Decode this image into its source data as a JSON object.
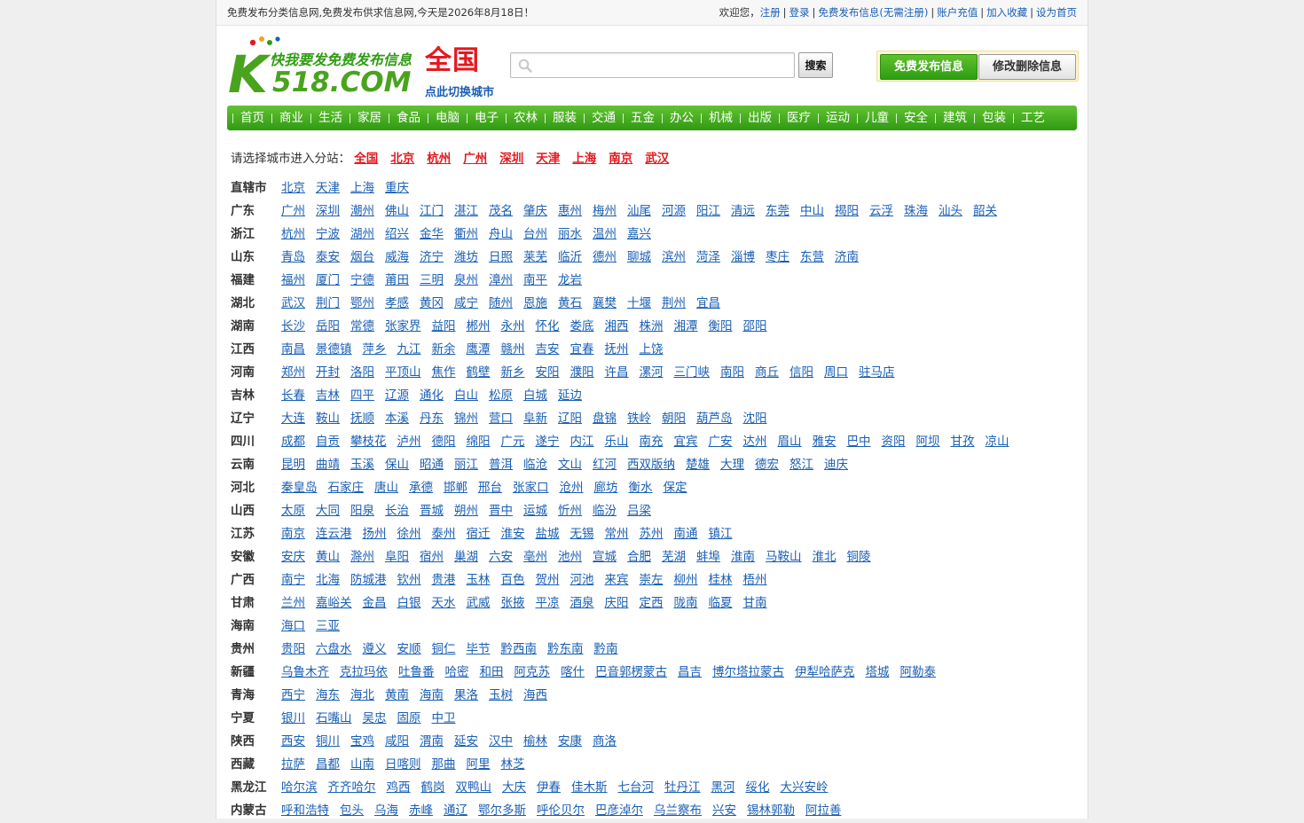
{
  "topbar": {
    "notice": "免费发布分类信息网,免费发布供求信息网,今天是2026年8月18日！",
    "welcome": "欢迎您，",
    "links": [
      "注册",
      "登录",
      "免费发布信息(无需注册)",
      "账户充值",
      "加入收藏",
      "设为首页"
    ]
  },
  "header": {
    "logo_text_top": "快我要发免费发布信息",
    "logo_text_bottom": "518.COM",
    "logo_letter": "K",
    "city": "全国",
    "switch_city": "点此切换城市",
    "search_button": "搜索",
    "search_value": "",
    "post_button": "免费发布信息",
    "edit_button": "修改删除信息"
  },
  "nav": [
    "首页",
    "商业",
    "生活",
    "家居",
    "食品",
    "电脑",
    "电子",
    "农林",
    "服装",
    "交通",
    "五金",
    "办公",
    "机械",
    "出版",
    "医疗",
    "运动",
    "儿童",
    "安全",
    "建筑",
    "包装",
    "工艺"
  ],
  "choose": {
    "label": "请选择城市进入分站：",
    "sites": [
      "全国",
      "北京",
      "杭州",
      "广州",
      "深圳",
      "天津",
      "上海",
      "南京",
      "武汉"
    ]
  },
  "regions": [
    {
      "name": "直辖市",
      "cities": [
        "北京",
        "天津",
        "上海",
        "重庆"
      ]
    },
    {
      "name": "广东",
      "cities": [
        "广州",
        "深圳",
        "潮州",
        "佛山",
        "江门",
        "湛江",
        "茂名",
        "肇庆",
        "惠州",
        "梅州",
        "汕尾",
        "河源",
        "阳江",
        "清远",
        "东莞",
        "中山",
        "揭阳",
        "云浮",
        "珠海",
        "汕头",
        "韶关"
      ]
    },
    {
      "name": "浙江",
      "cities": [
        "杭州",
        "宁波",
        "湖州",
        "绍兴",
        "金华",
        "衢州",
        "舟山",
        "台州",
        "丽水",
        "温州",
        "嘉兴"
      ]
    },
    {
      "name": "山东",
      "cities": [
        "青岛",
        "泰安",
        "烟台",
        "威海",
        "济宁",
        "潍坊",
        "日照",
        "莱芜",
        "临沂",
        "德州",
        "聊城",
        "滨州",
        "菏泽",
        "淄博",
        "枣庄",
        "东营",
        "济南"
      ]
    },
    {
      "name": "福建",
      "cities": [
        "福州",
        "厦门",
        "宁德",
        "莆田",
        "三明",
        "泉州",
        "漳州",
        "南平",
        "龙岩"
      ]
    },
    {
      "name": "湖北",
      "cities": [
        "武汉",
        "荆门",
        "鄂州",
        "孝感",
        "黄冈",
        "咸宁",
        "随州",
        "恩施",
        "黄石",
        "襄樊",
        "十堰",
        "荆州",
        "宜昌"
      ]
    },
    {
      "name": "湖南",
      "cities": [
        "长沙",
        "岳阳",
        "常德",
        "张家界",
        "益阳",
        "郴州",
        "永州",
        "怀化",
        "娄底",
        "湘西",
        "株洲",
        "湘潭",
        "衡阳",
        "邵阳"
      ]
    },
    {
      "name": "江西",
      "cities": [
        "南昌",
        "景德镇",
        "萍乡",
        "九江",
        "新余",
        "鹰潭",
        "赣州",
        "吉安",
        "宜春",
        "抚州",
        "上饶"
      ]
    },
    {
      "name": "河南",
      "cities": [
        "郑州",
        "开封",
        "洛阳",
        "平顶山",
        "焦作",
        "鹤壁",
        "新乡",
        "安阳",
        "濮阳",
        "许昌",
        "漯河",
        "三门峡",
        "南阳",
        "商丘",
        "信阳",
        "周口",
        "驻马店"
      ]
    },
    {
      "name": "吉林",
      "cities": [
        "长春",
        "吉林",
        "四平",
        "辽源",
        "通化",
        "白山",
        "松原",
        "白城",
        "延边"
      ]
    },
    {
      "name": "辽宁",
      "cities": [
        "大连",
        "鞍山",
        "抚顺",
        "本溪",
        "丹东",
        "锦州",
        "营口",
        "阜新",
        "辽阳",
        "盘锦",
        "铁岭",
        "朝阳",
        "葫芦岛",
        "沈阳"
      ]
    },
    {
      "name": "四川",
      "cities": [
        "成都",
        "自贡",
        "攀枝花",
        "泸州",
        "德阳",
        "绵阳",
        "广元",
        "遂宁",
        "内江",
        "乐山",
        "南充",
        "宜宾",
        "广安",
        "达州",
        "眉山",
        "雅安",
        "巴中",
        "资阳",
        "阿坝",
        "甘孜",
        "凉山"
      ]
    },
    {
      "name": "云南",
      "cities": [
        "昆明",
        "曲靖",
        "玉溪",
        "保山",
        "昭通",
        "丽江",
        "普洱",
        "临沧",
        "文山",
        "红河",
        "西双版纳",
        "楚雄",
        "大理",
        "德宏",
        "怒江",
        "迪庆"
      ]
    },
    {
      "name": "河北",
      "cities": [
        "秦皇岛",
        "石家庄",
        "唐山",
        "承德",
        "邯郸",
        "邢台",
        "张家口",
        "沧州",
        "廊坊",
        "衡水",
        "保定"
      ]
    },
    {
      "name": "山西",
      "cities": [
        "太原",
        "大同",
        "阳泉",
        "长治",
        "晋城",
        "朔州",
        "晋中",
        "运城",
        "忻州",
        "临汾",
        "吕梁"
      ]
    },
    {
      "name": "江苏",
      "cities": [
        "南京",
        "连云港",
        "扬州",
        "徐州",
        "泰州",
        "宿迁",
        "淮安",
        "盐城",
        "无锡",
        "常州",
        "苏州",
        "南通",
        "镇江"
      ]
    },
    {
      "name": "安徽",
      "cities": [
        "安庆",
        "黄山",
        "滁州",
        "阜阳",
        "宿州",
        "巢湖",
        "六安",
        "亳州",
        "池州",
        "宣城",
        "合肥",
        "芜湖",
        "蚌埠",
        "淮南",
        "马鞍山",
        "淮北",
        "铜陵"
      ]
    },
    {
      "name": "广西",
      "cities": [
        "南宁",
        "北海",
        "防城港",
        "钦州",
        "贵港",
        "玉林",
        "百色",
        "贺州",
        "河池",
        "来宾",
        "崇左",
        "柳州",
        "桂林",
        "梧州"
      ]
    },
    {
      "name": "甘肃",
      "cities": [
        "兰州",
        "嘉峪关",
        "金昌",
        "白银",
        "天水",
        "武威",
        "张掖",
        "平凉",
        "酒泉",
        "庆阳",
        "定西",
        "陇南",
        "临夏",
        "甘南"
      ]
    },
    {
      "name": "海南",
      "cities": [
        "海口",
        "三亚"
      ]
    },
    {
      "name": "贵州",
      "cities": [
        "贵阳",
        "六盘水",
        "遵义",
        "安顺",
        "铜仁",
        "毕节",
        "黔西南",
        "黔东南",
        "黔南"
      ]
    },
    {
      "name": "新疆",
      "cities": [
        "乌鲁木齐",
        "克拉玛依",
        "吐鲁番",
        "哈密",
        "和田",
        "阿克苏",
        "喀什",
        "巴音郭楞蒙古",
        "昌吉",
        "博尔塔拉蒙古",
        "伊犁哈萨克",
        "塔城",
        "阿勒泰"
      ]
    },
    {
      "name": "青海",
      "cities": [
        "西宁",
        "海东",
        "海北",
        "黄南",
        "海南",
        "果洛",
        "玉树",
        "海西"
      ]
    },
    {
      "name": "宁夏",
      "cities": [
        "银川",
        "石嘴山",
        "吴忠",
        "固原",
        "中卫"
      ]
    },
    {
      "name": "陕西",
      "cities": [
        "西安",
        "铜川",
        "宝鸡",
        "咸阳",
        "渭南",
        "延安",
        "汉中",
        "榆林",
        "安康",
        "商洛"
      ]
    },
    {
      "name": "西藏",
      "cities": [
        "拉萨",
        "昌都",
        "山南",
        "日喀则",
        "那曲",
        "阿里",
        "林芝"
      ]
    },
    {
      "name": "黑龙江",
      "cities": [
        "哈尔滨",
        "齐齐哈尔",
        "鸡西",
        "鹤岗",
        "双鸭山",
        "大庆",
        "伊春",
        "佳木斯",
        "七台河",
        "牡丹江",
        "黑河",
        "绥化",
        "大兴安岭"
      ]
    },
    {
      "name": "内蒙古",
      "cities": [
        "呼和浩特",
        "包头",
        "乌海",
        "赤峰",
        "通辽",
        "鄂尔多斯",
        "呼伦贝尔",
        "巴彦淖尔",
        "乌兰察布",
        "兴安",
        "锡林郭勒",
        "阿拉善"
      ]
    }
  ]
}
